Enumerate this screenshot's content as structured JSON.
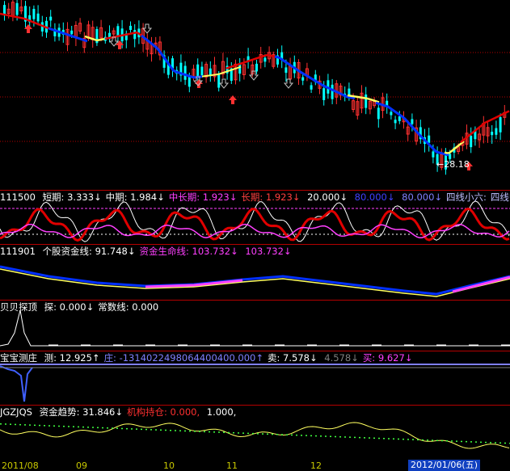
{
  "colors": {
    "up": "#ff3030",
    "down": "#00ffff",
    "yellow": "#ffff60",
    "blue": "#0030ff",
    "red": "#e00000",
    "magenta": "#ff40ff",
    "white": "#ffffff",
    "grid": "#b40000"
  },
  "main": {
    "low_annotation": "28.18"
  },
  "panel2": {
    "code": "111500",
    "items": [
      {
        "label": "短期:",
        "value": "3.333↓",
        "color": "#ffffff"
      },
      {
        "label": "中期:",
        "value": "1.984↓",
        "color": "#ffffff"
      },
      {
        "label": "中长期:",
        "value": "1.923↓",
        "color": "#ff40ff"
      },
      {
        "label": "长期:",
        "value": "1.923↓",
        "color": "#ff4040"
      },
      {
        "label": "",
        "value": "20.000↓",
        "color": "#ffffff"
      },
      {
        "label": "",
        "value": "80.000↓",
        "color": "#4040ff"
      },
      {
        "label": "",
        "value": "80.000↓",
        "color": "#8080ff"
      },
      {
        "label": "四线小六:",
        "value": "",
        "color": "#c0c0ff"
      },
      {
        "label": "四线归零:",
        "value": "",
        "color": "#c0c0ff"
      }
    ]
  },
  "panel3": {
    "code": "111901",
    "items": [
      {
        "label": "个股资金线:",
        "value": "91.748↓",
        "color": "#ffffff"
      },
      {
        "label": "资金生命线:",
        "value": "103.732↓",
        "color": "#ff40ff"
      },
      {
        "label": "",
        "value": "103.732↓",
        "color": "#ff40ff"
      }
    ]
  },
  "panel4": {
    "code": "贝贝探顶",
    "items": [
      {
        "label": "探:",
        "value": "0.000↓",
        "color": "#ffffff"
      },
      {
        "label": "常数线:",
        "value": "0.000",
        "color": "#ffffff"
      }
    ]
  },
  "panel5": {
    "code": "宝宝测庄",
    "items": [
      {
        "label": "测:",
        "value": "12.925↑",
        "color": "#ffffff"
      },
      {
        "label": "庄:",
        "value": "-1314022498064400400.000↑",
        "color": "#8080ff"
      },
      {
        "label": "卖:",
        "value": "7.578↓",
        "color": "#ffffff"
      },
      {
        "label": "",
        "value": "4.578↓",
        "color": "#808080"
      },
      {
        "label": "买:",
        "value": "9.627↓",
        "color": "#ff40ff"
      }
    ]
  },
  "panel6": {
    "code": "JGZJQS",
    "items": [
      {
        "label": "资金趋势:",
        "value": "31.846↓",
        "color": "#ffffff"
      },
      {
        "label": "机构持仓:",
        "value": "0.000,",
        "color": "#ff3030"
      },
      {
        "label": "",
        "value": "1.000,",
        "color": "#ffffff"
      }
    ]
  },
  "datebar": {
    "labels": [
      "2011/08",
      "09",
      "10",
      "11",
      "12"
    ],
    "highlight": "2012/01/06(五)"
  }
}
